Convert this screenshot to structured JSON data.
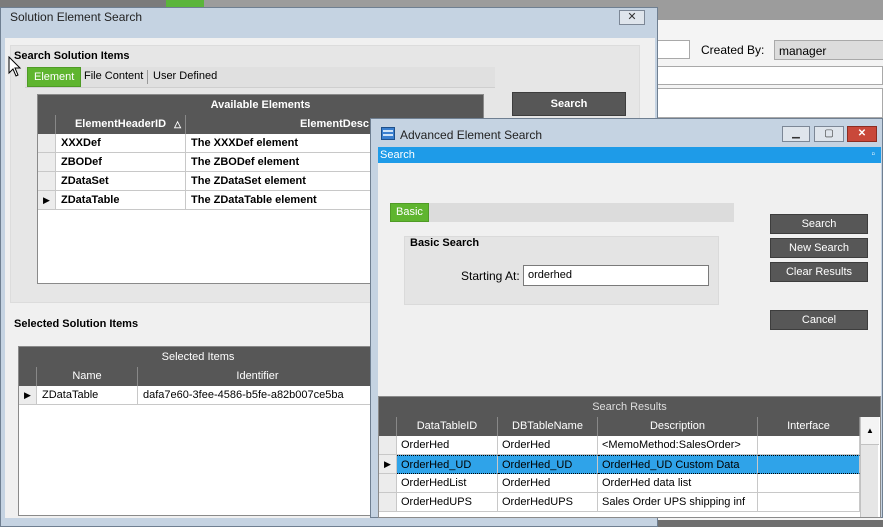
{
  "background": {
    "created_by_label": "Created By:",
    "created_by_value": "manager"
  },
  "solution_window": {
    "title": "Solution Element Search",
    "close_icon": "close-icon",
    "search_section_label": "Search Solution Items",
    "tabs": [
      "Element",
      "File Content",
      "User Defined"
    ],
    "search_button": "Search",
    "available_grid": {
      "caption": "Available Elements",
      "columns": [
        "ElementHeaderID",
        "ElementDesc"
      ],
      "rows": [
        [
          "XXXDef",
          "The XXXDef element"
        ],
        [
          "ZBODef",
          "The ZBODef element"
        ],
        [
          "ZDataSet",
          "The ZDataSet element"
        ],
        [
          "ZDataTable",
          "The ZDataTable element"
        ]
      ]
    },
    "selected_section_label": "Selected Solution Items",
    "selected_grid": {
      "caption": "Selected Items",
      "columns": [
        "Name",
        "Identifier"
      ],
      "rows": [
        [
          "ZDataTable",
          "dafa7e60-3fee-4586-b5fe-a82b007ce5ba"
        ]
      ]
    }
  },
  "advanced_window": {
    "title": "Advanced Element Search",
    "search_bar_label": "Search",
    "tab_basic": "Basic",
    "basic_search_label": "Basic Search",
    "starting_at_label": "Starting At:",
    "starting_at_value": "orderhed",
    "buttons": {
      "search": "Search",
      "new_search": "New Search",
      "clear_results": "Clear Results",
      "cancel": "Cancel"
    },
    "results": {
      "caption": "Search Results",
      "columns": [
        "DataTableID",
        "DBTableName",
        "Description",
        "Interface"
      ],
      "rows": [
        [
          "OrderHed",
          "OrderHed",
          "<MemoMethod:SalesOrder>",
          ""
        ],
        [
          "OrderHed_UD",
          "OrderHed_UD",
          "OrderHed_UD Custom Data",
          ""
        ],
        [
          "OrderHedList",
          "OrderHed",
          "OrderHed data list",
          ""
        ],
        [
          "OrderHedUPS",
          "OrderHedUPS",
          "Sales Order UPS shipping inf",
          ""
        ]
      ]
    }
  },
  "colors": {
    "accent_green": "#5fb52f",
    "title_blue": "#1e9be8",
    "selection_blue": "#2fa3e9",
    "grid_header": "#575757"
  }
}
